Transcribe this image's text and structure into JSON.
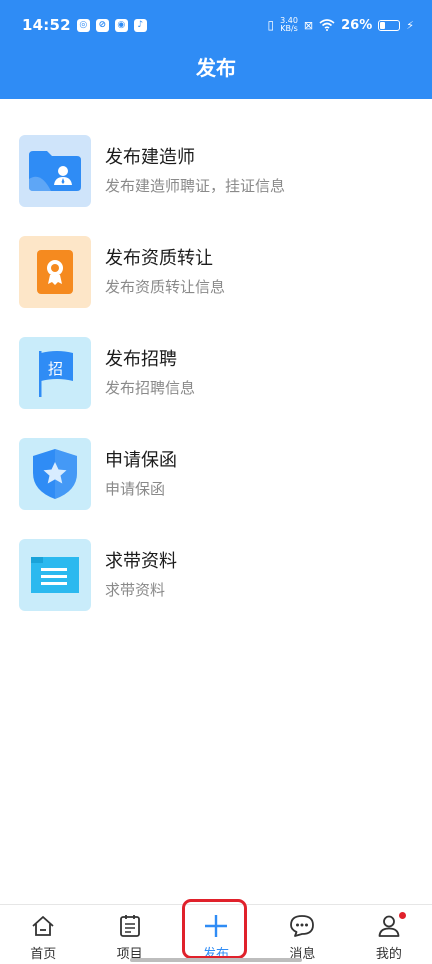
{
  "status_bar": {
    "time": "14:52",
    "net_speed_value": "3.40",
    "net_speed_unit": "KB/s",
    "battery": "26%"
  },
  "header": {
    "title": "发布"
  },
  "menu": {
    "items": [
      {
        "title": "发布建造师",
        "subtitle": "发布建造师聘证，挂证信息",
        "icon": "folder-person-icon"
      },
      {
        "title": "发布资质转让",
        "subtitle": "发布资质转让信息",
        "icon": "certificate-icon"
      },
      {
        "title": "发布招聘",
        "subtitle": "发布招聘信息",
        "icon": "recruit-flag-icon",
        "icon_text": "招"
      },
      {
        "title": "申请保函",
        "subtitle": "申请保函",
        "icon": "shield-star-icon"
      },
      {
        "title": "求带资料",
        "subtitle": "求带资料",
        "icon": "document-icon"
      }
    ]
  },
  "bottom_nav": {
    "items": [
      {
        "label": "首页",
        "icon": "home-icon"
      },
      {
        "label": "项目",
        "icon": "clipboard-icon"
      },
      {
        "label": "发布",
        "icon": "plus-icon",
        "active": true
      },
      {
        "label": "消息",
        "icon": "chat-icon"
      },
      {
        "label": "我的",
        "icon": "person-icon",
        "badge": true
      }
    ]
  },
  "colors": {
    "accent": "#2f8cf5",
    "highlight": "#e0212b",
    "icon_bg_blue": "#cfe4fa",
    "icon_bg_orange": "#fde6c8",
    "icon_bg_cyan": "#c9ecfa"
  }
}
